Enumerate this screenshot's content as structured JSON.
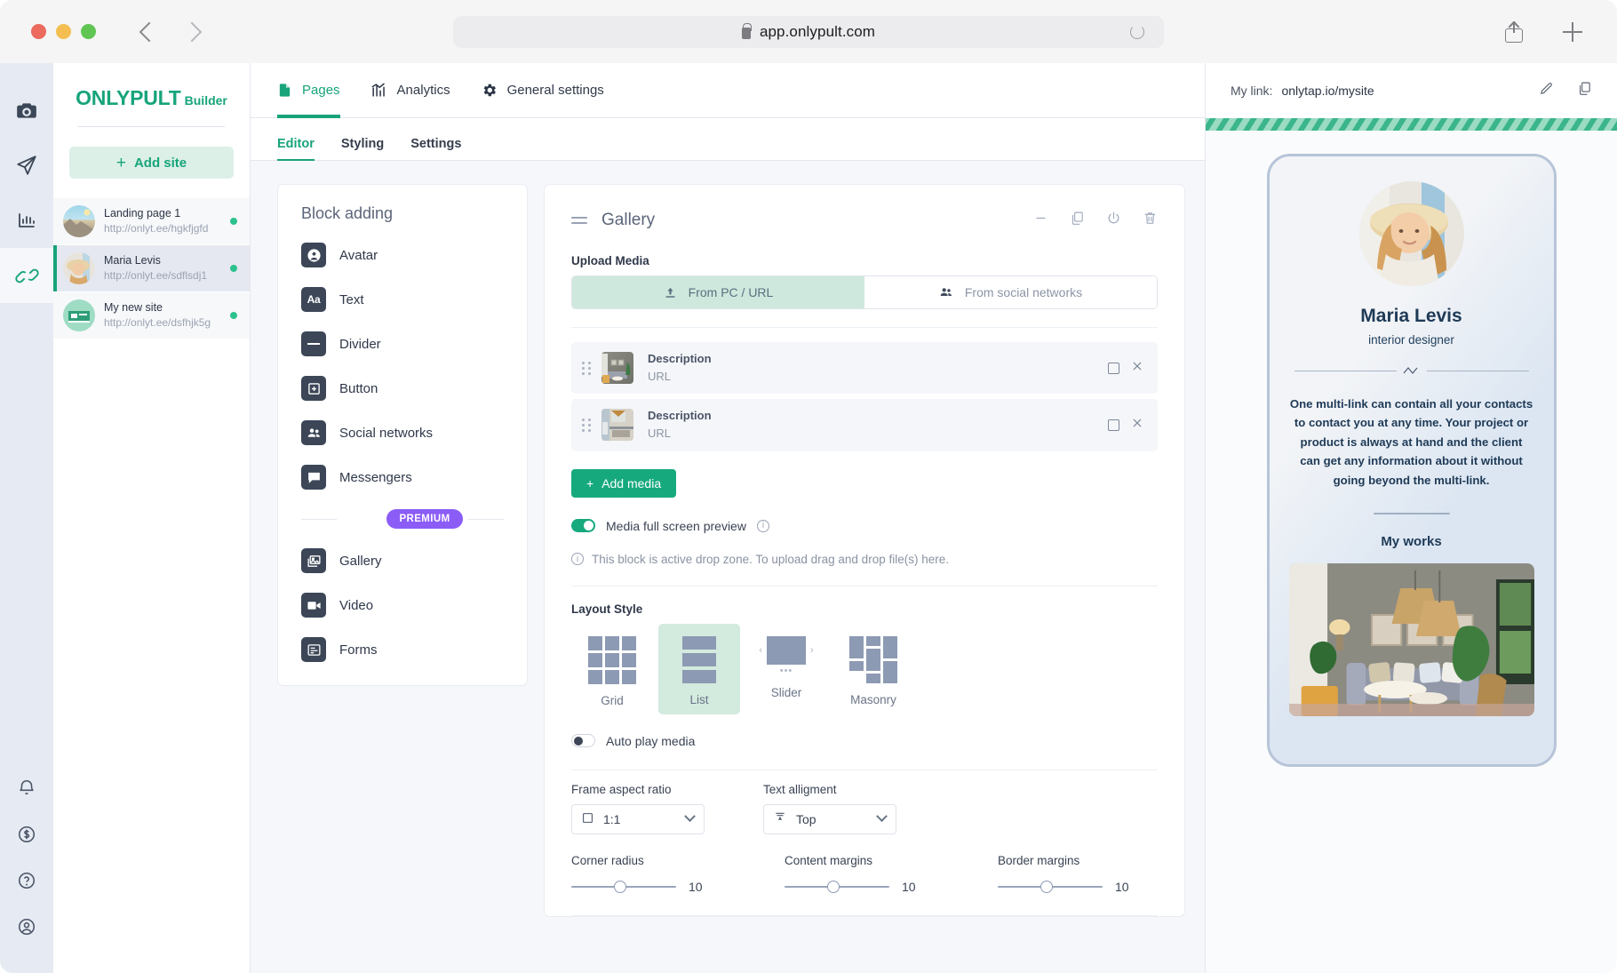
{
  "browser": {
    "url": "app.onlypult.com",
    "back_icon": "chevron-left-icon",
    "forward_icon": "chevron-right-icon",
    "reload_icon": "reload-icon",
    "lock_icon": "lock-icon",
    "share_icon": "share-icon",
    "newtab_icon": "plus-icon"
  },
  "rail": {
    "items": [
      {
        "name": "instagram-icon"
      },
      {
        "name": "send-icon"
      },
      {
        "name": "analytics-icon"
      },
      {
        "name": "link-icon",
        "active": true
      }
    ],
    "bottom": [
      {
        "name": "bell-icon"
      },
      {
        "name": "dollar-icon"
      },
      {
        "name": "help-icon"
      },
      {
        "name": "account-icon"
      }
    ]
  },
  "sidebar": {
    "brand_main": "ONLYPULT",
    "brand_sub": "Builder",
    "add_site_label": "Add site",
    "add_site_plus": "+",
    "sites": [
      {
        "name": "Landing page 1",
        "url": "http://onlyt.ee/hgkfjgfd",
        "selected": false
      },
      {
        "name": "Maria Levis",
        "url": "http://onlyt.ee/sdflsdj1",
        "selected": true
      },
      {
        "name": "My new site",
        "url": "http://onlyt.ee/dsfhjk5g",
        "selected": false
      }
    ]
  },
  "topnav": [
    {
      "label": "Pages",
      "icon": "page-icon",
      "active": true
    },
    {
      "label": "Analytics",
      "icon": "chart-icon",
      "active": false
    },
    {
      "label": "General settings",
      "icon": "gear-icon",
      "active": false
    }
  ],
  "subtabs": [
    {
      "label": "Editor",
      "active": true
    },
    {
      "label": "Styling",
      "active": false
    },
    {
      "label": "Settings",
      "active": false
    }
  ],
  "block_panel": {
    "title": "Block adding",
    "items": [
      {
        "label": "Avatar",
        "icon": "avatar-icon"
      },
      {
        "label": "Text",
        "icon": "text-aa-icon"
      },
      {
        "label": "Divider",
        "icon": "divider-icon"
      },
      {
        "label": "Button",
        "icon": "button-plus-icon"
      },
      {
        "label": "Social networks",
        "icon": "people-icon"
      },
      {
        "label": "Messengers",
        "icon": "chat-icon"
      }
    ],
    "premium_badge": "PREMIUM",
    "premium_items": [
      {
        "label": "Gallery",
        "icon": "gallery-icon"
      },
      {
        "label": "Video",
        "icon": "video-icon"
      },
      {
        "label": "Forms",
        "icon": "forms-icon"
      }
    ]
  },
  "gallery_card": {
    "title": "Gallery",
    "drag_handle_icon": "drag-handle-icon",
    "actions": [
      {
        "name": "minimize-icon"
      },
      {
        "name": "duplicate-icon"
      },
      {
        "name": "power-icon"
      },
      {
        "name": "delete-icon"
      }
    ],
    "upload_label": "Upload Media",
    "upload_tabs": [
      {
        "label": "From PC / URL",
        "icon": "upload-icon",
        "active": true
      },
      {
        "label": "From social networks",
        "icon": "people-icon",
        "active": false
      }
    ],
    "media_rows": [
      {
        "description": "Description",
        "url": "URL"
      },
      {
        "description": "Description",
        "url": "URL"
      }
    ],
    "add_media_label": "Add media",
    "add_media_plus": "+",
    "fullscreen_toggle": {
      "label": "Media full screen preview",
      "on": true
    },
    "drop_note": "This block is active drop zone. To upload drag and drop file(s) here.",
    "layout_style_label": "Layout Style",
    "layouts": [
      {
        "label": "Grid",
        "selected": false
      },
      {
        "label": "List",
        "selected": true
      },
      {
        "label": "Slider",
        "selected": false
      },
      {
        "label": "Masonry",
        "selected": false
      }
    ],
    "autoplay_toggle": {
      "label": "Auto play media",
      "on": false
    },
    "frame_aspect": {
      "label": "Frame aspect ratio",
      "value": "1:1",
      "icon": "square-icon"
    },
    "text_alignment": {
      "label": "Text alligment",
      "value": "Top",
      "icon": "align-top-icon"
    },
    "sliders": [
      {
        "label": "Corner radius",
        "value": "10"
      },
      {
        "label": "Content margins",
        "value": "10"
      },
      {
        "label": "Border margins",
        "value": "10"
      }
    ]
  },
  "preview": {
    "link_label": "My link:",
    "link_value": "onlytap.io/mysite",
    "edit_icon": "pencil-icon",
    "copy_icon": "copy-icon",
    "profile_name": "Maria Levis",
    "profile_role": "interior designer",
    "profile_text": "One multi-link can contain all your contacts to contact you at any time. Your project or product is always at hand and the client can get any information about it without going beyond the multi-link.",
    "works_title": "My works"
  },
  "colors": {
    "accent_green": "#17a47b",
    "premium_purple": "#8b5cf6",
    "status_green": "#2cc28d",
    "dark_navy": "#1e3a57"
  }
}
